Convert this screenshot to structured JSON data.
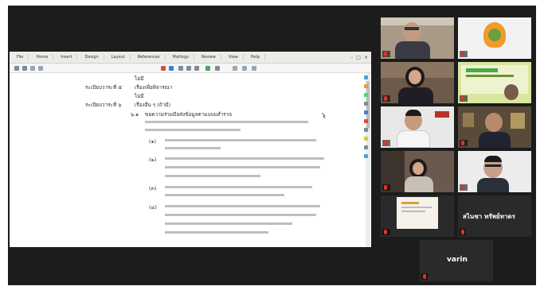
{
  "document_window": {
    "tabs": [
      "File",
      "Home",
      "Insert",
      "Design",
      "Layout",
      "References",
      "Mailings",
      "Review",
      "View",
      "Help"
    ],
    "lines": [
      "ไม่มี",
      "ระเบียบวาระที่ ๕",
      "เรื่องเพื่อพิจารณา",
      "ไม่มี",
      "ระเบียบวาระที่ ๖",
      "เรื่องอื่น ๆ (ถ้ามี)",
      "๖.๑",
      "ขอความร่วมมือส่งข้อมูลตามแบบสำรวจ",
      "",
      "(๑)",
      "",
      "(๒)",
      "",
      "",
      "(๓)",
      "",
      "(๔)",
      "",
      ""
    ]
  },
  "participants": {
    "tiles": [
      {
        "name": "",
        "style": "man-glasses"
      },
      {
        "name": "",
        "style": "logo"
      },
      {
        "name": "",
        "style": "woman"
      },
      {
        "name": "",
        "style": "slide"
      },
      {
        "name": "",
        "style": "man-white"
      },
      {
        "name": "",
        "style": "man-dark"
      },
      {
        "name": "",
        "style": "woman-room"
      },
      {
        "name": "",
        "style": "man-glasses-2"
      },
      {
        "name": "",
        "style": "doc"
      },
      {
        "name": "สไนชา ทรัพย์ทาดร",
        "style": "text-only"
      }
    ],
    "bottom_tile": {
      "name": "varin"
    }
  },
  "colors": {
    "background": "#1c1c1c",
    "mic_muted": "#e0312b",
    "tile": "#2a2a2a"
  }
}
